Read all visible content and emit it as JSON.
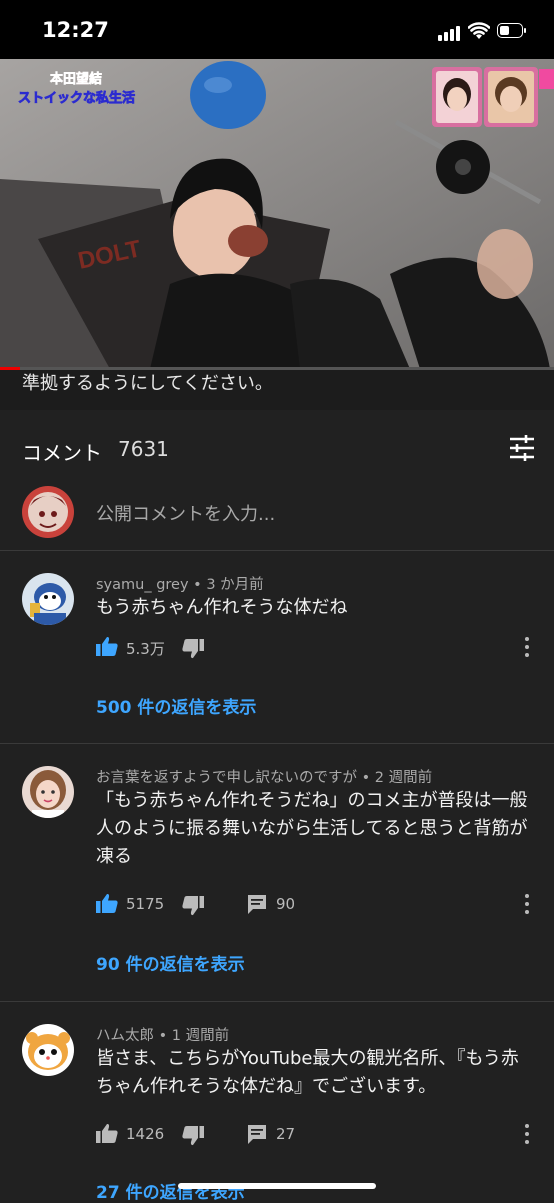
{
  "status_bar": {
    "time": "12:27"
  },
  "video": {
    "caption_name": "本田望結",
    "caption_subtitle": "ストイックな私生活",
    "mat_text": "DOLT"
  },
  "description_tail": "準拠するようにしてください。",
  "comments": {
    "title": "コメント",
    "count": "7631",
    "input_placeholder": "公開コメントを入力...",
    "items": [
      {
        "author": "syamu_ grey",
        "age": "3 か月前",
        "meta": "syamu_ grey • 3 か月前",
        "text": "もう赤ちゃん作れそうな体だね",
        "likes": "5.3万",
        "replies": "",
        "view_replies": "500 件の返信を表示"
      },
      {
        "author": "お言葉を返すようで申し訳ないのですが",
        "age": "2 週間前",
        "meta": "お言葉を返すようで申し訳ないのですが • 2 週間前",
        "text": "「もう赤ちゃん作れそうだね」のコメ主が普段は一般人のように振る舞いながら生活してると思うと背筋が凍る",
        "likes": "5175",
        "replies": "90",
        "view_replies": "90 件の返信を表示"
      },
      {
        "author": "ハム太郎",
        "age": "1 週間前",
        "meta": "ハム太郎 • 1 週間前",
        "text": "皆さま、こちらがYouTube最大の観光名所、『もう赤ちゃん作れそうな体だね』でございます。",
        "likes": "1426",
        "replies": "27",
        "view_replies": "27 件の返信を表示"
      }
    ]
  },
  "colors": {
    "background": "#212121",
    "link": "#3ea6ff",
    "like_active": "#3ea6ff",
    "progress": "#ee0000"
  },
  "icons": [
    "signal-icon",
    "wifi-icon",
    "battery-icon",
    "sort-icon",
    "like-icon",
    "dislike-icon",
    "reply-icon",
    "more-vert-icon"
  ]
}
